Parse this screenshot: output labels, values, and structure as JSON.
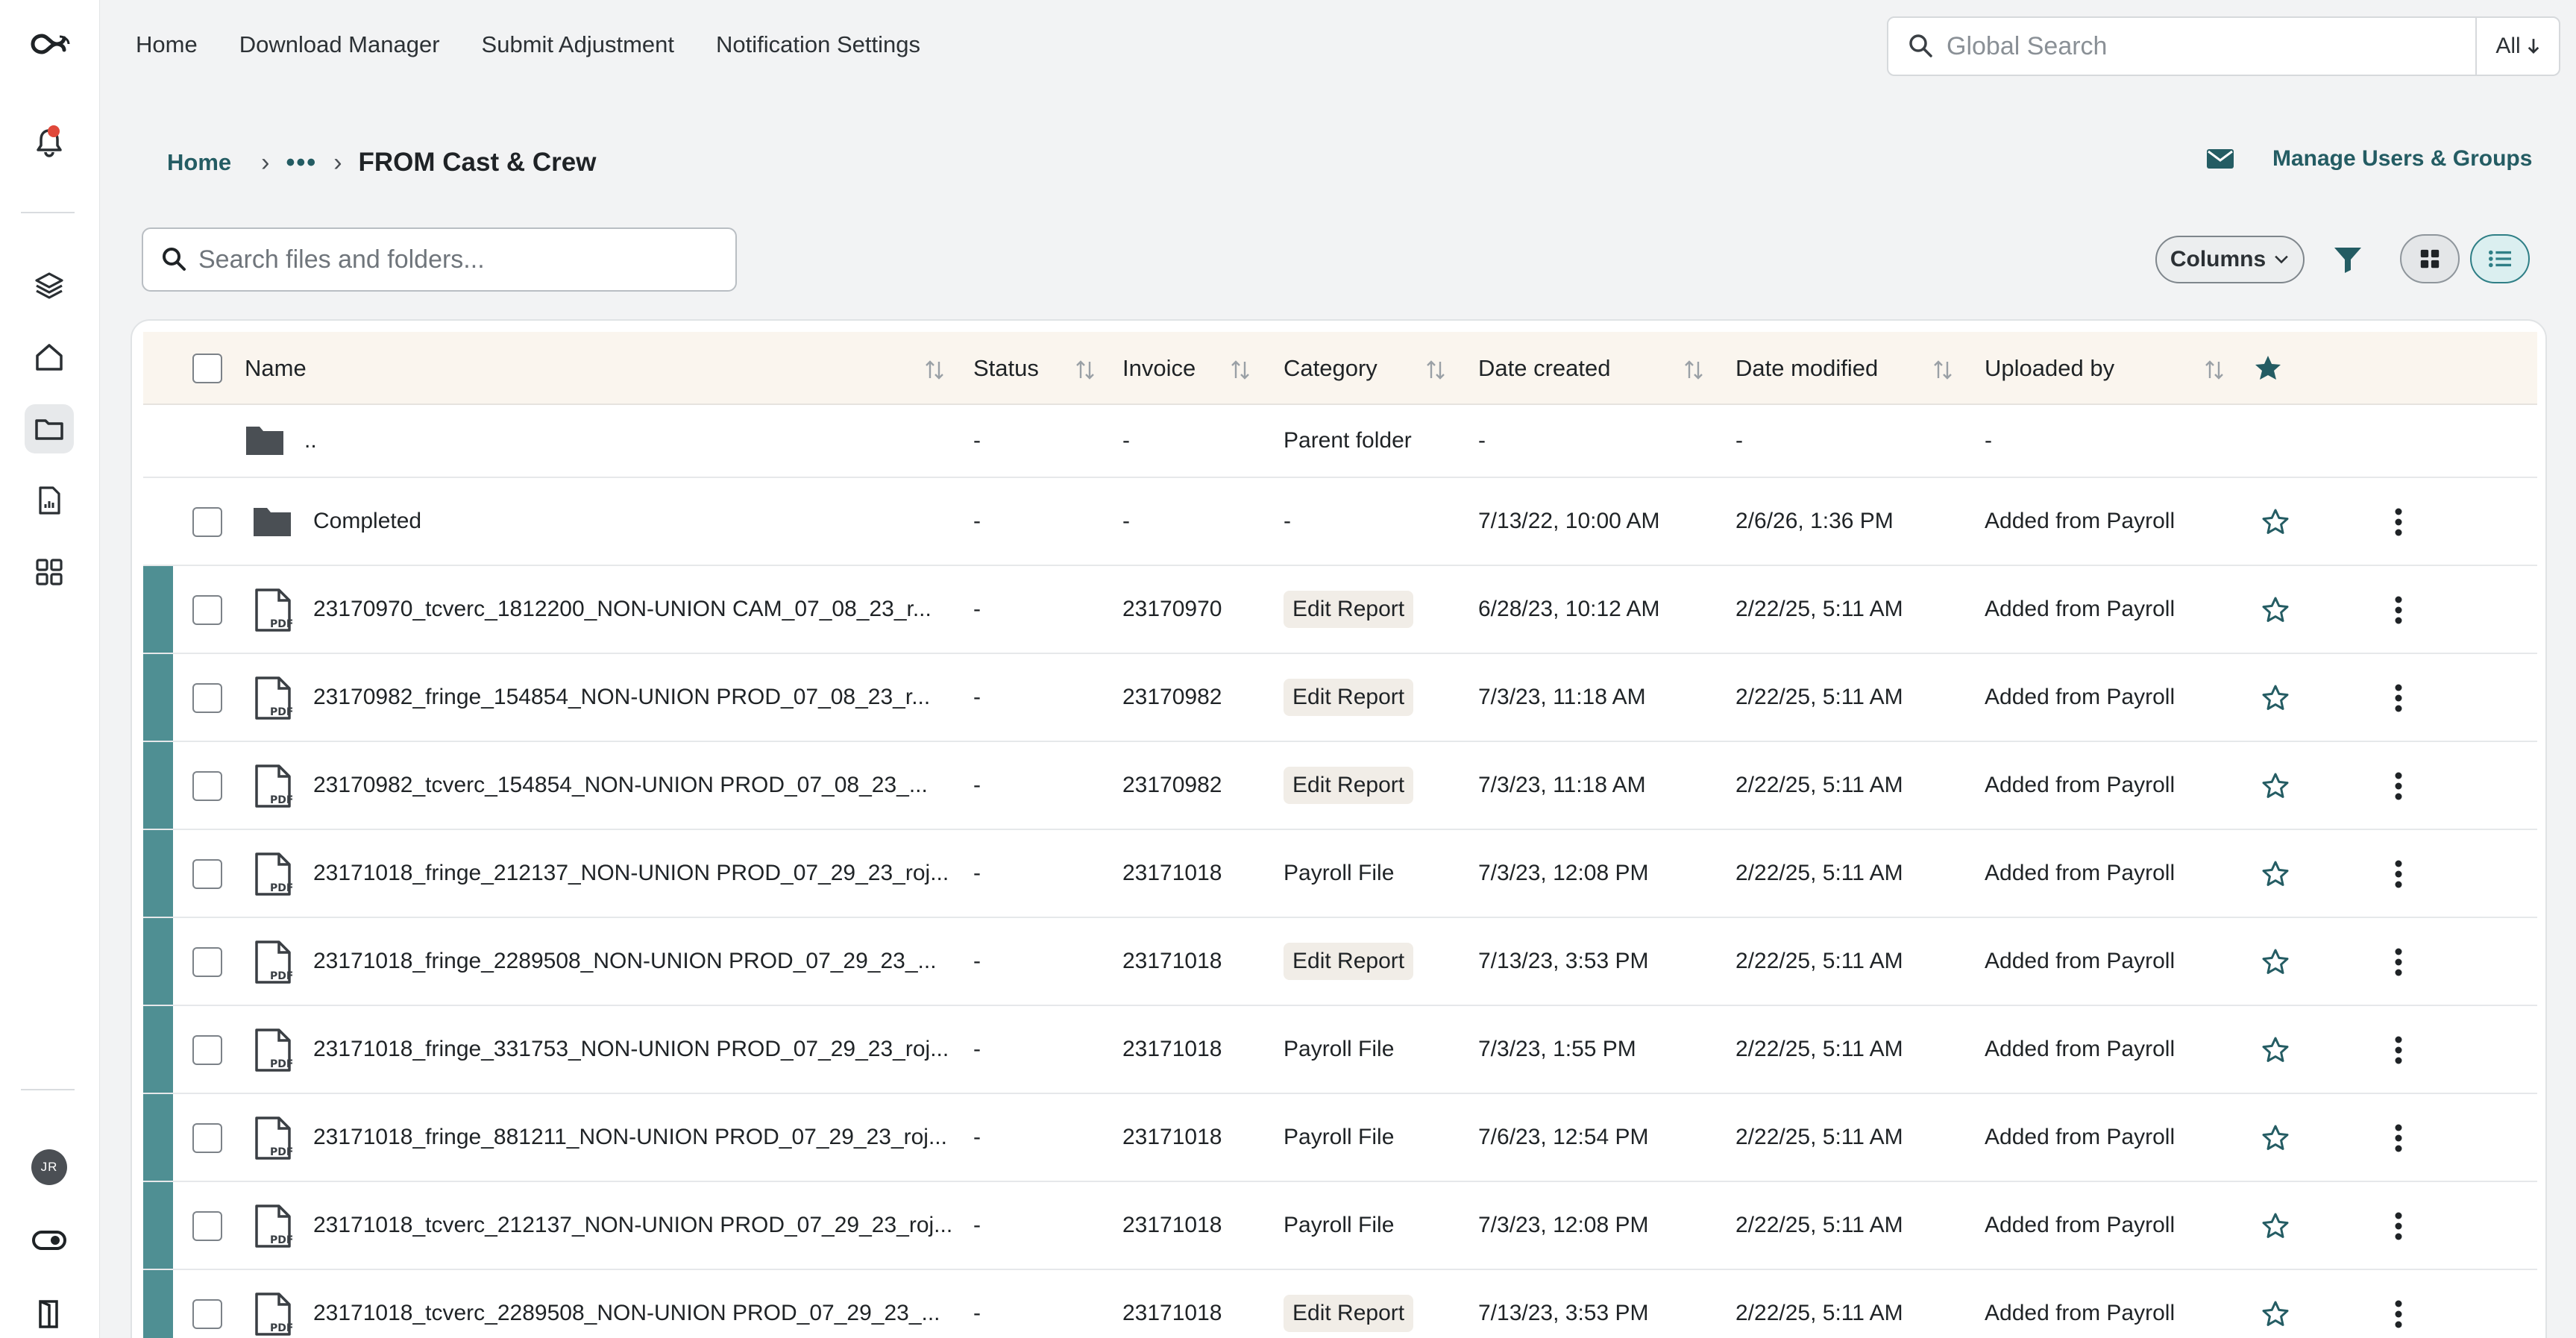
{
  "app": {
    "notification_initials": "JR"
  },
  "nav": {
    "items": [
      "Home",
      "Download Manager",
      "Submit Adjustment",
      "Notification Settings"
    ]
  },
  "global_search": {
    "placeholder": "Global Search",
    "scope": "All"
  },
  "breadcrumb": {
    "home": "Home",
    "ellipsis": "•••",
    "current": "FROM Cast & Crew"
  },
  "manage_users": "Manage Users & Groups",
  "file_search": {
    "placeholder": "Search files and folders..."
  },
  "toolbar": {
    "columns_label": "Columns"
  },
  "colors": {
    "accent": "#245c63",
    "row_bar": "#4f8f93"
  },
  "table": {
    "headers": {
      "name": "Name",
      "status": "Status",
      "invoice": "Invoice",
      "category": "Category",
      "date_created": "Date created",
      "date_modified": "Date modified",
      "uploaded_by": "Uploaded by"
    },
    "parent": {
      "name": "..",
      "status": "-",
      "invoice": "-",
      "category": "Parent folder",
      "date_created": "-",
      "date_modified": "-",
      "uploaded_by": "-"
    },
    "rows": [
      {
        "type": "folder",
        "name": "Completed",
        "status": "-",
        "invoice": "-",
        "category": "-",
        "pill": false,
        "date_created": "7/13/22, 10:00 AM",
        "date_modified": "2/6/26, 1:36 PM",
        "uploaded_by": "Added from Payroll"
      },
      {
        "type": "pdf",
        "name": "23170970_tcverc_1812200_NON-UNION CAM_07_08_23_r...",
        "status": "-",
        "invoice": "23170970",
        "category": "Edit Report",
        "pill": true,
        "date_created": "6/28/23, 10:12 AM",
        "date_modified": "2/22/25, 5:11 AM",
        "uploaded_by": "Added from Payroll"
      },
      {
        "type": "pdf",
        "name": "23170982_fringe_154854_NON-UNION PROD_07_08_23_r...",
        "status": "-",
        "invoice": "23170982",
        "category": "Edit Report",
        "pill": true,
        "date_created": "7/3/23, 11:18 AM",
        "date_modified": "2/22/25, 5:11 AM",
        "uploaded_by": "Added from Payroll"
      },
      {
        "type": "pdf",
        "name": "23170982_tcverc_154854_NON-UNION PROD_07_08_23_...",
        "status": "-",
        "invoice": "23170982",
        "category": "Edit Report",
        "pill": true,
        "date_created": "7/3/23, 11:18 AM",
        "date_modified": "2/22/25, 5:11 AM",
        "uploaded_by": "Added from Payroll"
      },
      {
        "type": "pdf",
        "name": "23171018_fringe_212137_NON-UNION PROD_07_29_23_roj...",
        "status": "-",
        "invoice": "23171018",
        "category": "Payroll File",
        "pill": false,
        "date_created": "7/3/23, 12:08 PM",
        "date_modified": "2/22/25, 5:11 AM",
        "uploaded_by": "Added from Payroll"
      },
      {
        "type": "pdf",
        "name": "23171018_fringe_2289508_NON-UNION PROD_07_29_23_...",
        "status": "-",
        "invoice": "23171018",
        "category": "Edit Report",
        "pill": true,
        "date_created": "7/13/23, 3:53 PM",
        "date_modified": "2/22/25, 5:11 AM",
        "uploaded_by": "Added from Payroll"
      },
      {
        "type": "pdf",
        "name": "23171018_fringe_331753_NON-UNION PROD_07_29_23_roj...",
        "status": "-",
        "invoice": "23171018",
        "category": "Payroll File",
        "pill": false,
        "date_created": "7/3/23, 1:55 PM",
        "date_modified": "2/22/25, 5:11 AM",
        "uploaded_by": "Added from Payroll"
      },
      {
        "type": "pdf",
        "name": "23171018_fringe_881211_NON-UNION PROD_07_29_23_roj...",
        "status": "-",
        "invoice": "23171018",
        "category": "Payroll File",
        "pill": false,
        "date_created": "7/6/23, 12:54 PM",
        "date_modified": "2/22/25, 5:11 AM",
        "uploaded_by": "Added from Payroll"
      },
      {
        "type": "pdf",
        "name": "23171018_tcverc_212137_NON-UNION PROD_07_29_23_roj...",
        "status": "-",
        "invoice": "23171018",
        "category": "Payroll File",
        "pill": false,
        "date_created": "7/3/23, 12:08 PM",
        "date_modified": "2/22/25, 5:11 AM",
        "uploaded_by": "Added from Payroll"
      },
      {
        "type": "pdf",
        "name": "23171018_tcverc_2289508_NON-UNION PROD_07_29_23_...",
        "status": "-",
        "invoice": "23171018",
        "category": "Edit Report",
        "pill": true,
        "date_created": "7/13/23, 3:53 PM",
        "date_modified": "2/22/25, 5:11 AM",
        "uploaded_by": "Added from Payroll"
      }
    ]
  }
}
